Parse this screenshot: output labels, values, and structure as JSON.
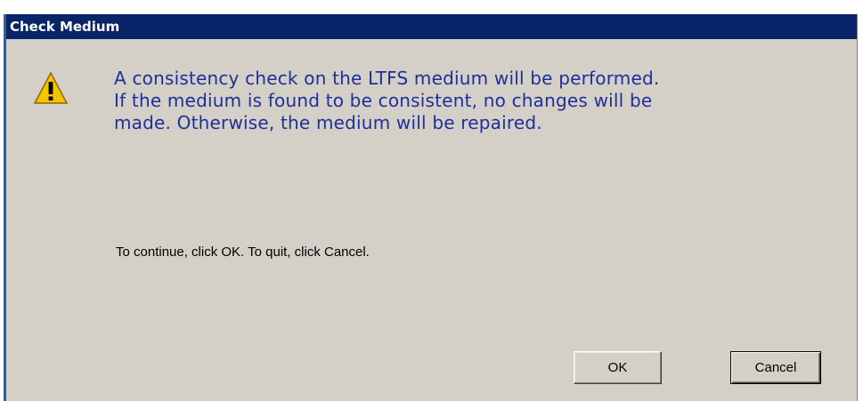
{
  "dialog": {
    "title": "Check Medium",
    "icon": "warning-icon",
    "message_lines": [
      "A consistency check on the LTFS medium will be performed.",
      "If the medium is found to be consistent, no changes will be",
      "made. Otherwise, the medium will be repaired."
    ],
    "instruction": "To continue, click OK. To quit, click Cancel.",
    "buttons": {
      "ok_label": "OK",
      "cancel_label": "Cancel"
    }
  },
  "colors": {
    "titlebar": "#0a246a",
    "title_text": "#ffffff",
    "dialog_bg": "#d4d0c8",
    "message_text": "#1f2f9a",
    "warning_fill": "#f5c400"
  }
}
